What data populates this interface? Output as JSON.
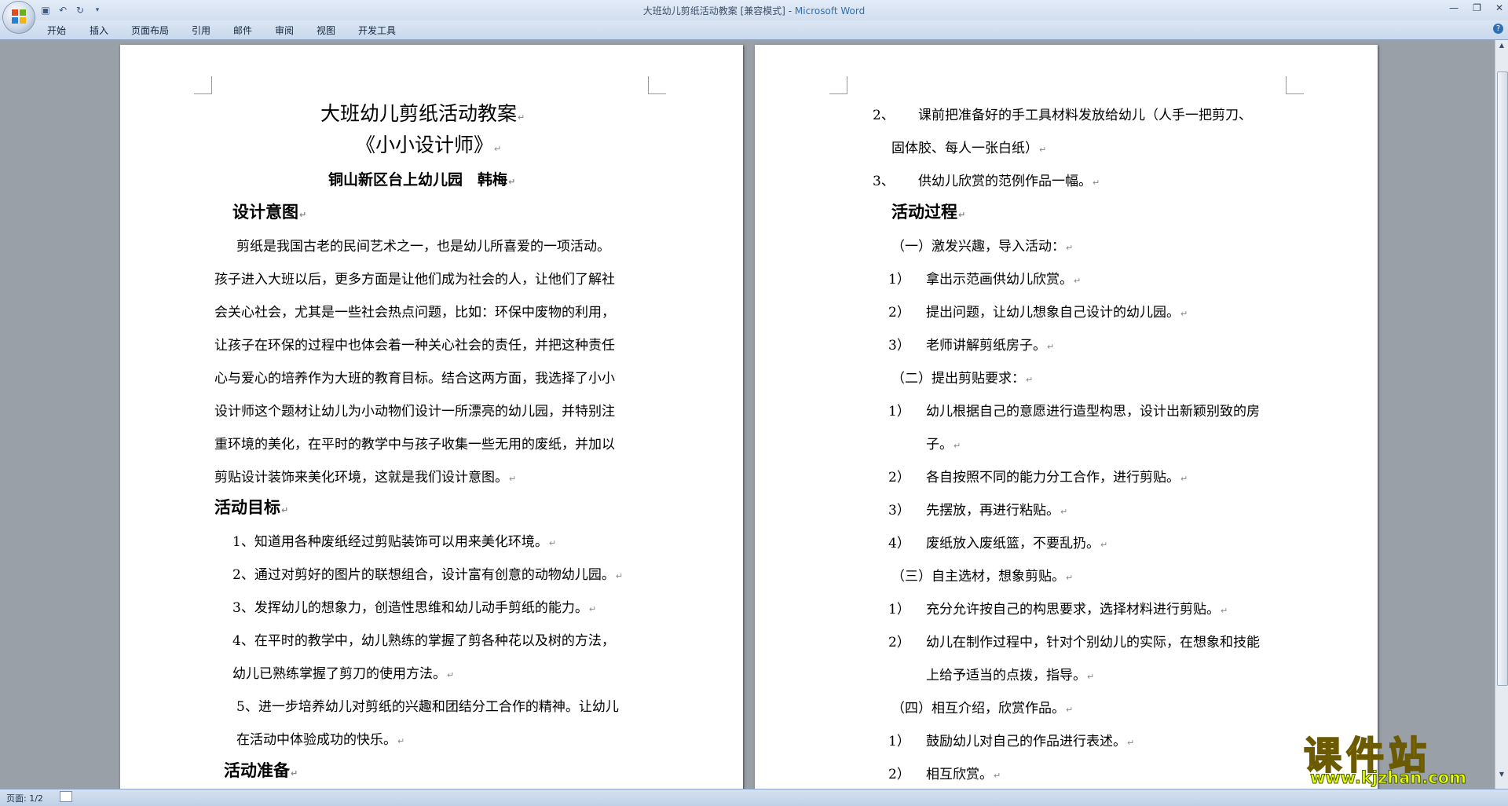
{
  "window": {
    "title_doc": "大班幼儿剪纸活动教案 [兼容模式] - ",
    "title_app": "Microsoft Word"
  },
  "ribbon": {
    "tabs": [
      "开始",
      "插入",
      "页面布局",
      "引用",
      "邮件",
      "审阅",
      "视图",
      "开发工具"
    ]
  },
  "left_page": {
    "title": "大班幼儿剪纸活动教案",
    "subtitle": "《小小设计师》",
    "author": "铜山新区台上幼儿园　韩梅",
    "h_intent": "设计意图",
    "intent_lines": [
      "剪纸是我国古老的民间艺术之一，也是幼儿所喜爱的一项活动。",
      "孩子进入大班以后，更多方面是让他们成为社会的人，让他们了解社",
      "会关心社会，尤其是一些社会热点问题，比如：环保中废物的利用，",
      "让孩子在环保的过程中也体会着一种关心社会的责任，并把这种责任",
      "心与爱心的培养作为大班的教育目标。结合这两方面，我选择了小小",
      "设计师这个题材让幼儿为小动物们设计一所漂亮的幼儿园，并特别注",
      "重环境的美化，在平时的教学中与孩子收集一些无用的废纸，并加以",
      "剪贴设计装饰来美化环境，这就是我们设计意图。"
    ],
    "h_goals": "活动目标",
    "goal_lines": [
      "1、知道用各种废纸经过剪贴装饰可以用来美化环境。",
      "2、通过对剪好的图片的联想组合，设计富有创意的动物幼儿园。",
      "3、发挥幼儿的想象力，创造性思维和幼儿动手剪纸的能力。",
      "4、在平时的教学中，幼儿熟练的掌握了剪各种花以及树的方法，",
      "幼儿已熟练掌握了剪刀的使用方法。",
      "5、进一步培养幼儿对剪纸的兴趣和团结分工合作的精神。让幼儿",
      "在活动中体验成功的快乐。"
    ],
    "h_prep": "活动准备"
  },
  "right_page": {
    "prep_lines": [
      {
        "num": "2、",
        "text": "课前把准备好的手工具材料发放给幼儿（人手一把剪刀、"
      },
      {
        "num": "",
        "text": "固体胶、每人一张白纸）"
      },
      {
        "num": "3、",
        "text": "供幼儿欣赏的范例作品一幅。"
      }
    ],
    "h_process": "活动过程",
    "process_lines": [
      {
        "num": "",
        "text": "（一）激发兴趣，导入活动："
      },
      {
        "num": "1）",
        "text": "拿出示范画供幼儿欣赏。"
      },
      {
        "num": "2）",
        "text": "提出问题，让幼儿想象自己设计的幼儿园。"
      },
      {
        "num": "3）",
        "text": "老师讲解剪纸房子。"
      },
      {
        "num": "",
        "text": "（二）提出剪贴要求："
      },
      {
        "num": "1）",
        "text": "幼儿根据自己的意愿进行造型构思，设计出新颖别致的房"
      },
      {
        "num": "",
        "text": "子。"
      },
      {
        "num": "2）",
        "text": "各自按照不同的能力分工合作，进行剪贴。"
      },
      {
        "num": "3）",
        "text": "先摆放，再进行粘贴。"
      },
      {
        "num": "4）",
        "text": "废纸放入废纸篮，不要乱扔。"
      },
      {
        "num": "",
        "text": "（三）自主选材，想象剪贴。"
      },
      {
        "num": "1）",
        "text": "充分允许按自己的构思要求，选择材料进行剪贴。"
      },
      {
        "num": "2）",
        "text": "幼儿在制作过程中，针对个别幼儿的实际，在想象和技能"
      },
      {
        "num": "",
        "text": "上给予适当的点拨，指导。"
      },
      {
        "num": "",
        "text": "（四）相互介绍，欣赏作品。"
      },
      {
        "num": "1）",
        "text": "鼓励幼儿对自己的作品进行表述。"
      },
      {
        "num": "2）",
        "text": "相互欣赏。"
      }
    ]
  },
  "status": {
    "page": "页面: 1/2"
  },
  "watermark": {
    "main": "课件站",
    "url": "www.kjzhan.com"
  }
}
